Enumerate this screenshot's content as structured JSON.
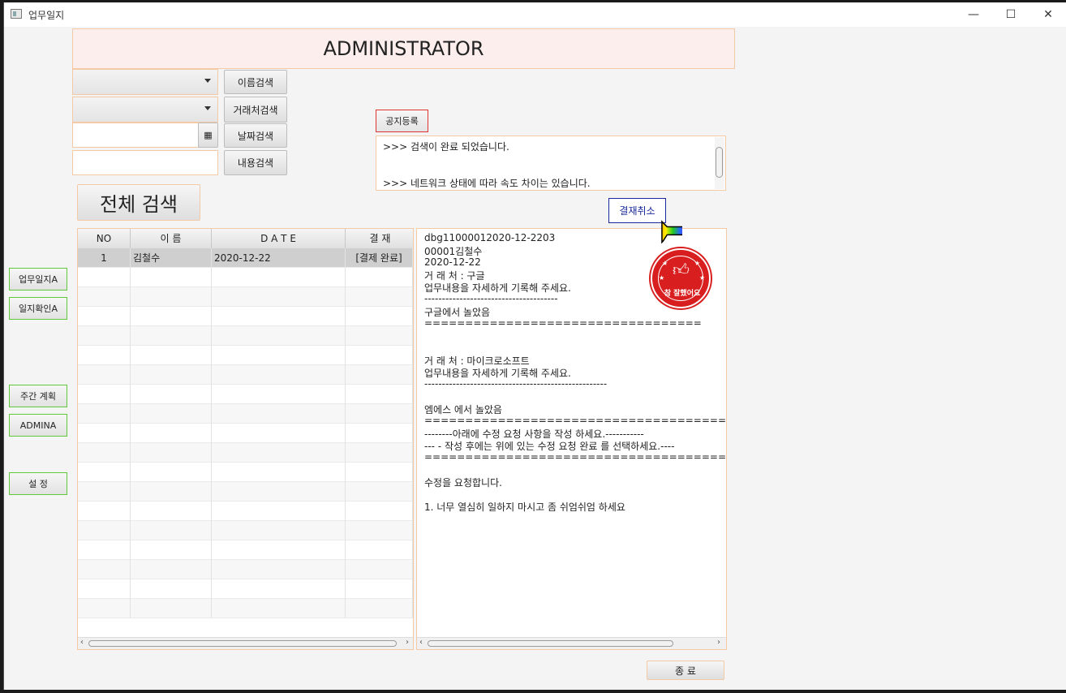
{
  "window": {
    "title": "업무일지",
    "minimize": "—",
    "maximize": "☐",
    "close": "✕"
  },
  "header": {
    "title": "ADMINISTRATOR"
  },
  "search": {
    "name_button": "이름검색",
    "vendor_button": "거래처검색",
    "date_button": "날짜검색",
    "content_button": "내용검색",
    "all_button": "전체 검색",
    "date_value": "",
    "content_value": ""
  },
  "notice": {
    "register_button": "공지등록",
    "lines": [
      ">>> 검색이 완료 되었습니다.",
      ">>> 네트워크 상태에 따라 속도 차이는 있습니다."
    ]
  },
  "cancel_approval_button": "결재취소",
  "sidebar": {
    "items": [
      {
        "label": "업무일지A"
      },
      {
        "label": "일지확인A"
      },
      {
        "label": "주간 계획"
      },
      {
        "label": "ADMINA"
      },
      {
        "label": "설   정"
      }
    ]
  },
  "table": {
    "columns": [
      "NO",
      "이   름",
      "D  A  T  E",
      "결  재"
    ],
    "rows": [
      {
        "no": "1",
        "name": "김철수",
        "date": "2020-12-22",
        "status": "[결제 완료]"
      }
    ]
  },
  "detail": {
    "lines": [
      "dbg11000012020-12-2203",
      "00001김철수",
      "2020-12-22",
      "거 래 처 : 구글",
      "업무내용을 자세하게 기록해 주세요.",
      "--------------------------------------",
      "구글에서 놀았음",
      "==================================",
      "",
      "",
      "거 래 처 : 마이크로소프트",
      "업무내용을 자세하게 기록해 주세요.",
      "----------------------------------------------------",
      "",
      "엠에스 에서 놀았음",
      "=======================================",
      "--------아래에 수정 요청 사항을 작성 하세요.-----------",
      "--- - 작성 후에는 위에 있는 수정 요청 완료 를 선택하세요.----",
      "=======================================",
      "",
      "수정을 요청합니다.",
      "",
      "1. 너무 열심히 일하지 마시고 좀 쉬엄쉬엄 하세요"
    ],
    "stamp_text": "참 잘했어요"
  },
  "close_button": "종   료",
  "colors": {
    "accent_border": "#f4c9a6",
    "green_border": "#5fc93a",
    "stamp_red": "#d81e1e",
    "notice_red": "#d33"
  }
}
